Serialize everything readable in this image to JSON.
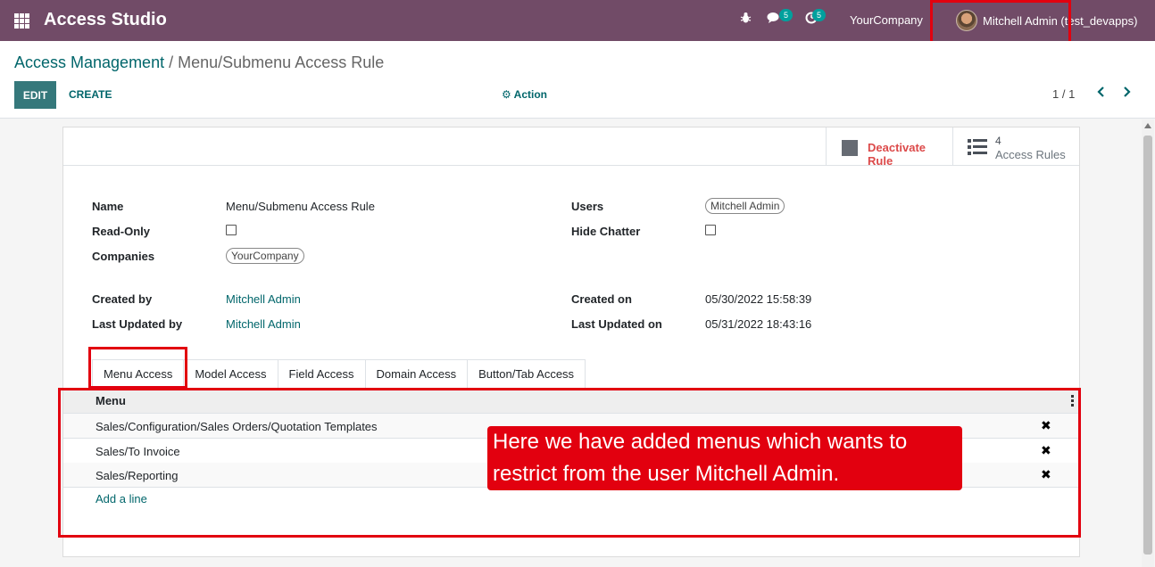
{
  "navbar": {
    "brand": "Access Studio",
    "chat_badge": "5",
    "activity_badge": "5",
    "company": "YourCompany",
    "user_label": "Mitchell Admin (test_devapps)"
  },
  "control_panel": {
    "breadcrumb_parent": "Access Management",
    "breadcrumb_separator": " / ",
    "breadcrumb_current": "Menu/Submenu Access Rule",
    "edit_label": "EDIT",
    "create_label": "CREATE",
    "action_label": "Action",
    "pager_value": "1 / 1"
  },
  "button_box": {
    "deactivate_label": "Deactivate Rule",
    "rules_count": "4",
    "rules_label": "Access Rules"
  },
  "form": {
    "name_label": "Name",
    "name_value": "Menu/Submenu Access Rule",
    "readonly_label": "Read-Only",
    "readonly_checked": false,
    "companies_label": "Companies",
    "companies_tag": "YourCompany",
    "users_label": "Users",
    "users_tag": "Mitchell Admin",
    "hide_chatter_label": "Hide Chatter",
    "hide_chatter_checked": false,
    "created_by_label": "Created by",
    "created_by_value": "Mitchell Admin",
    "last_updated_by_label": "Last Updated by",
    "last_updated_by_value": "Mitchell Admin",
    "created_on_label": "Created on",
    "created_on_value": "05/30/2022 15:58:39",
    "last_updated_on_label": "Last Updated on",
    "last_updated_on_value": "05/31/2022 18:43:16"
  },
  "tabs": [
    "Menu Access",
    "Model Access",
    "Field Access",
    "Domain Access",
    "Button/Tab Access"
  ],
  "menu_list": {
    "header": "Menu",
    "rows": [
      "Sales/Configuration/Sales Orders/Quotation Templates",
      "Sales/To Invoice",
      "Sales/Reporting"
    ],
    "add_line_label": "Add a line"
  },
  "callout": {
    "text": "Here we have added menus which wants to restrict from the user Mitchell Admin."
  },
  "colors": {
    "navbar": "#714b67",
    "accent": "#01666b",
    "highlight": "#e2000f",
    "deactivate": "#dc4a4a"
  }
}
